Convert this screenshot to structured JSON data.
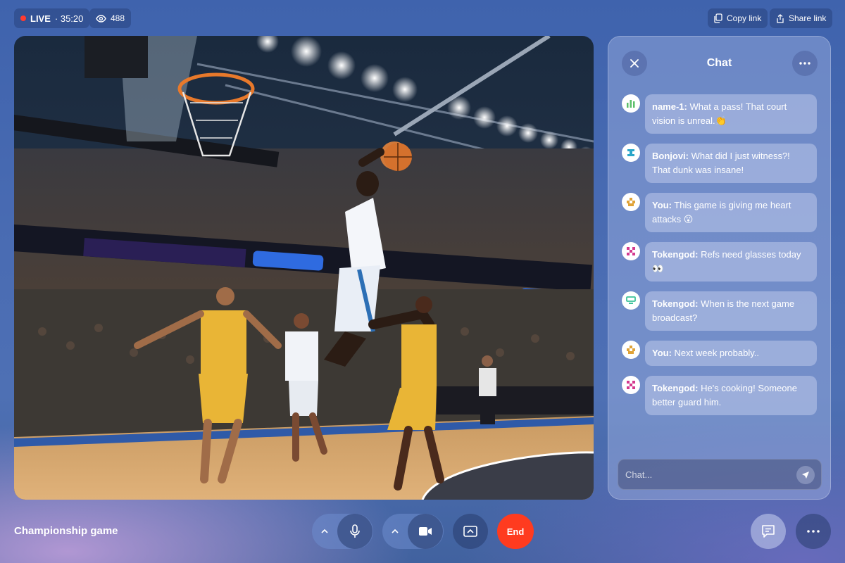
{
  "top_bar": {
    "live_label": "LIVE",
    "live_time": "· 35:20",
    "viewer_count": "488",
    "copy_link_label": "Copy link",
    "share_link_label": "Share link"
  },
  "video": {
    "icon": "basketball-dunk-video"
  },
  "chat": {
    "title": "Chat",
    "messages": [
      {
        "author": "name-1:",
        "text": " What a pass! That court vision is unreal.👏",
        "avatar_color": "#5bbf6a"
      },
      {
        "author": "Bonjovi:",
        "text": " What did I just witness?! That dunk was insane!",
        "avatar_color": "#2ba6c9"
      },
      {
        "author": "You:",
        "text": " This game is giving me heart attacks 😮",
        "avatar_color": "#e0a338"
      },
      {
        "author": "Tokengod:",
        "text": " Refs need glasses today 👀",
        "avatar_color": "#d43a8f"
      },
      {
        "author": "Tokengod:",
        "text": " When is the next game broadcast?",
        "avatar_color": "#3ec29a"
      },
      {
        "author": "You:",
        "text": " Next week probably..",
        "avatar_color": "#e0a338"
      },
      {
        "author": "Tokengod:",
        "text": " He's cooking! Someone better guard him.",
        "avatar_color": "#d43a8f"
      }
    ],
    "input_placeholder": "Chat..."
  },
  "bottom_bar": {
    "stream_title": "Championship game",
    "end_label": "End"
  },
  "colors": {
    "live_dot": "#ff3b30",
    "end_button": "#ff3b1f"
  }
}
